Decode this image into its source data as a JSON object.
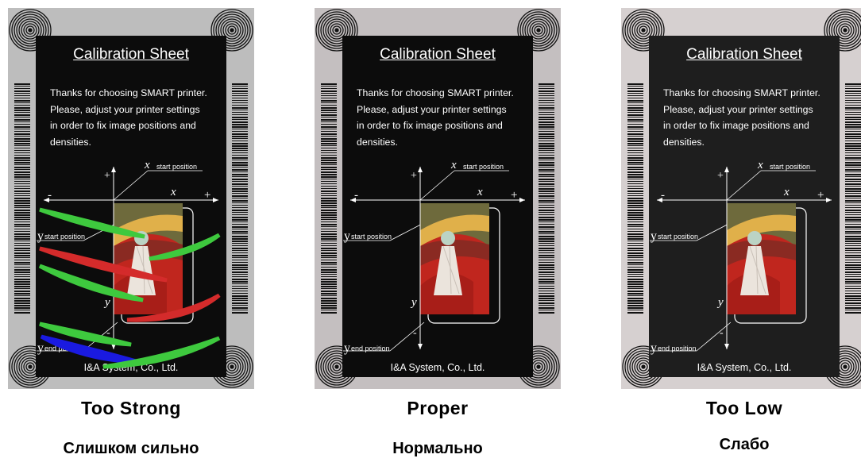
{
  "sheet": {
    "title": "Calibration Sheet",
    "desc_lines": [
      "Thanks for choosing SMART printer.",
      "Please, adjust your printer settings",
      "in order to fix image positions and",
      "densities."
    ],
    "x_symbol": "x",
    "x_start_label": "start position",
    "y_symbol": "y",
    "y_start_label": "start position",
    "y_end_label": "end position",
    "plus": "+",
    "minus": "-",
    "company": "I&A System, Co., Ltd."
  },
  "panels": [
    {
      "caption_en": "Too Strong",
      "caption_ru": "Слишком сильно",
      "border_color": "#bdbdbd"
    },
    {
      "caption_en": "Proper",
      "caption_ru": "Нормально",
      "border_color": "#c4bfc0"
    },
    {
      "caption_en": "Too Low",
      "caption_ru": "Слабо",
      "border_color": "#d6d0d0"
    }
  ],
  "colors": {
    "stroke_green": "#3ec93e",
    "stroke_red": "#d42b2b",
    "stroke_blue": "#1a1ae0"
  }
}
